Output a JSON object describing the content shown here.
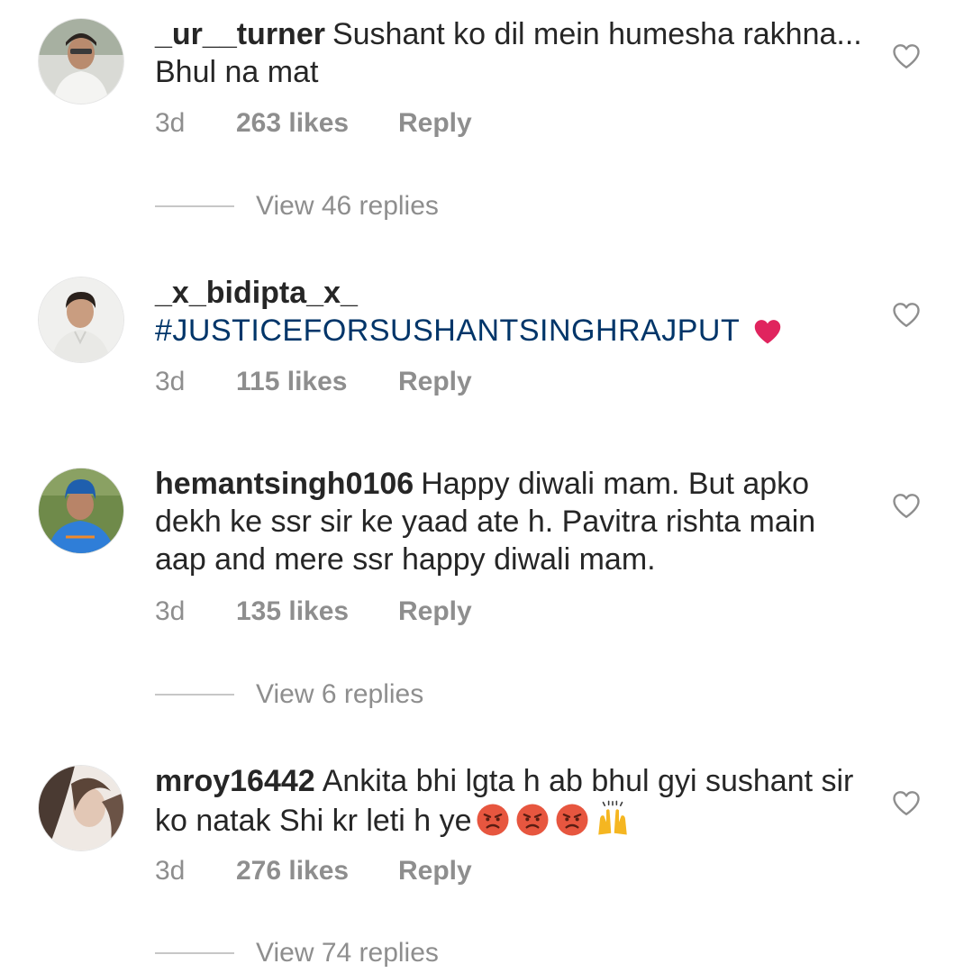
{
  "comments": [
    {
      "username": "_ur__turner",
      "text": "Sushant ko dil mein humesha rakhna... Bhul na mat",
      "time": "3d",
      "likes": "263 likes",
      "reply_label": "Reply",
      "view_replies": "View 46 replies"
    },
    {
      "username": "_x_bidipta_x_",
      "text": "#JUSTICEFORSUSHANTSINGHRAJPUT",
      "emoji": "red-heart-emoji",
      "time": "3d",
      "likes": "115 likes",
      "reply_label": "Reply"
    },
    {
      "username": "hemantsingh0106",
      "text": "Happy diwali mam. But apko dekh ke ssr sir ke yaad ate h. Pavitra rishta main aap and mere ssr  happy diwali mam.",
      "time": "3d",
      "likes": "135 likes",
      "reply_label": "Reply",
      "view_replies": "View 6 replies"
    },
    {
      "username": "mroy16442",
      "text": "Ankita bhi lgta h ab bhul gyi sushant sir ko natak Shi kr leti h ye",
      "emojis": [
        "angry-face-emoji",
        "angry-face-emoji",
        "angry-face-emoji",
        "raising-hands-emoji"
      ],
      "time": "3d",
      "likes": "276 likes",
      "reply_label": "Reply",
      "view_replies": "View 74 replies"
    }
  ],
  "icons": {
    "like": "heart-outline-icon"
  },
  "colors": {
    "text": "#262626",
    "muted": "#8e8e8e",
    "hashtag": "#003569",
    "heart_emoji": "#e0245e"
  }
}
